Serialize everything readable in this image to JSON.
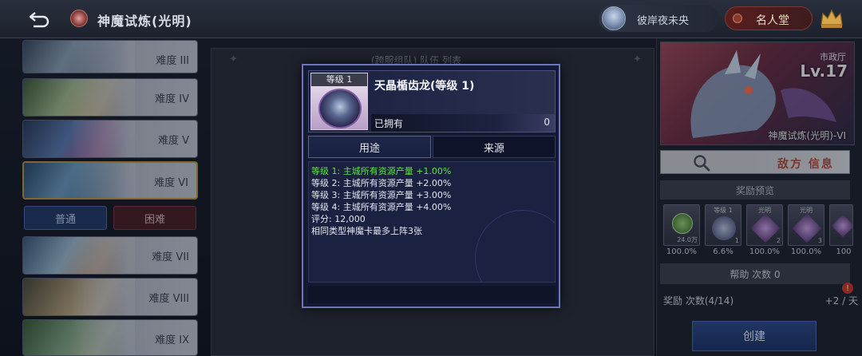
{
  "header": {
    "title": "神魔试炼(光明)",
    "player_name": "彼岸夜未央",
    "hall_of_fame": "名人堂"
  },
  "difficulty_list": {
    "items": [
      {
        "label": "难度 III"
      },
      {
        "label": "难度 IV"
      },
      {
        "label": "难度 V"
      },
      {
        "label": "难度 VI",
        "selected": true
      },
      {
        "label": "难度 VII"
      },
      {
        "label": "难度 VIII"
      },
      {
        "label": "难度 IX"
      }
    ],
    "modes": {
      "normal": "普通",
      "hard": "困难"
    }
  },
  "center": {
    "title": "(跨服组队) 队伍 列表"
  },
  "boss": {
    "city_hall": "市政厅",
    "level": "Lv.17",
    "name": "神魔试炼(光明)-VI",
    "enemy_info": "敌方 信息"
  },
  "rewards": {
    "preview_title": "奖励预览",
    "items": [
      {
        "caption": "",
        "qty": "24.0万",
        "pct": "100.0%"
      },
      {
        "caption": "等级 1",
        "qty": "1",
        "pct": "6.6%"
      },
      {
        "caption": "光明",
        "qty": "2",
        "pct": "100.0%"
      },
      {
        "caption": "光明",
        "qty": "3",
        "pct": "100.0%"
      },
      {
        "caption": "",
        "qty": "",
        "pct": "100"
      }
    ],
    "help_count": "帮助 次数 0",
    "reward_count": "奖励 次数(4/14)",
    "reward_rate": "+2 / 天",
    "alert_badge": "!",
    "create": "创建"
  },
  "modal": {
    "level_badge": "等级 1",
    "item_name": "天晶楯齿龙(等级 1)",
    "owned_label": "已拥有",
    "owned_count": "0",
    "tab_use": "用途",
    "tab_source": "来源",
    "lines": [
      "等级 1:  主城所有资源产量 +1.00%",
      "等级 2:  主城所有资源产量 +2.00%",
      "等级 3:  主城所有资源产量 +3.00%",
      "等级 4:  主城所有资源产量 +4.00%",
      "评分:  12,000",
      "相同类型神魔卡最多上阵3张"
    ]
  },
  "colors": {
    "accent_green": "#5fe04a",
    "modal_border": "#6f74b8",
    "enemy_label": "#b04a3a"
  }
}
